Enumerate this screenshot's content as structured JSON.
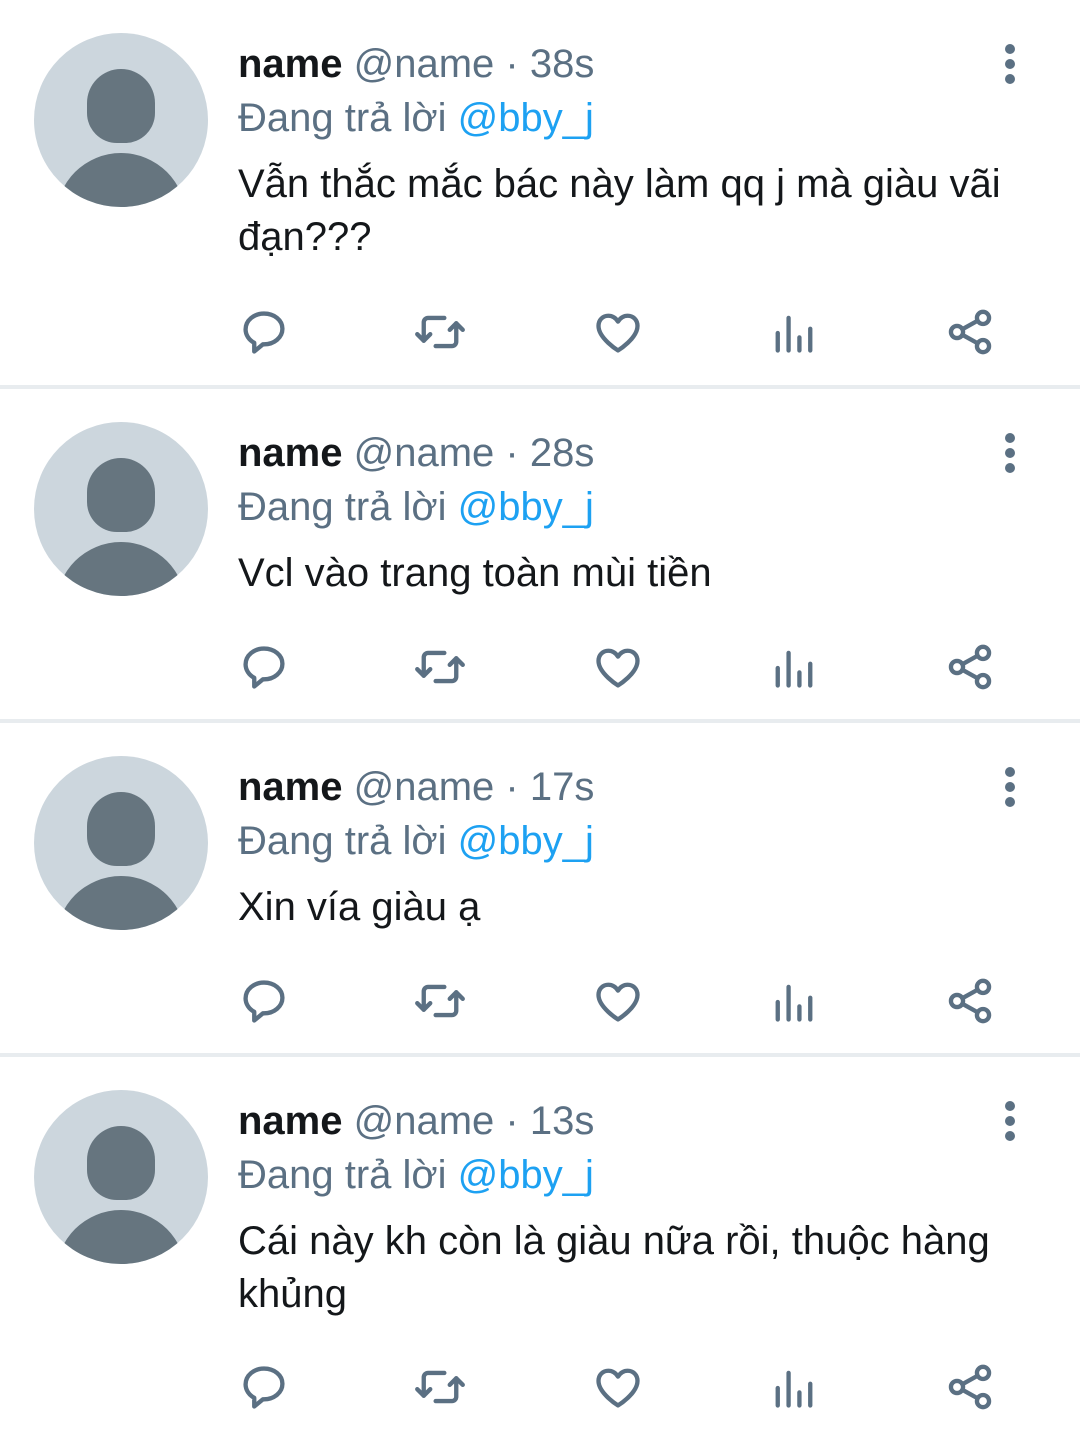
{
  "colors": {
    "avatar_background": "#ccd6dd",
    "avatar_silhouette": "#66757f",
    "secondary_text": "#5b7083",
    "link": "#1da1f2",
    "divider": "#e8ecef"
  },
  "tweets": [
    {
      "display_name": "name",
      "handle": "@name",
      "separator": "·",
      "time": "38s",
      "reply_prefix": "Đang trả lời",
      "reply_to": "@bby_j",
      "text": "Vẫn thắc mắc bác này làm qq j mà giàu vãi đạn???"
    },
    {
      "display_name": "name",
      "handle": "@name",
      "separator": "·",
      "time": "28s",
      "reply_prefix": "Đang trả lời",
      "reply_to": "@bby_j",
      "text": "Vcl vào trang toàn mùi tiền"
    },
    {
      "display_name": "name",
      "handle": "@name",
      "separator": "·",
      "time": "17s",
      "reply_prefix": "Đang trả lời",
      "reply_to": "@bby_j",
      "text": "Xin vía giàu ạ"
    },
    {
      "display_name": "name",
      "handle": "@name",
      "separator": "·",
      "time": "13s",
      "reply_prefix": "Đang trả lời",
      "reply_to": "@bby_j",
      "text": "Cái này kh còn là giàu nữa rồi, thuộc hàng khủng"
    }
  ],
  "action_icons": [
    "reply-icon",
    "retweet-icon",
    "like-icon",
    "analytics-icon",
    "share-icon"
  ],
  "more_icon": "more-vertical-icon",
  "avatar_icon": "default-avatar-icon"
}
